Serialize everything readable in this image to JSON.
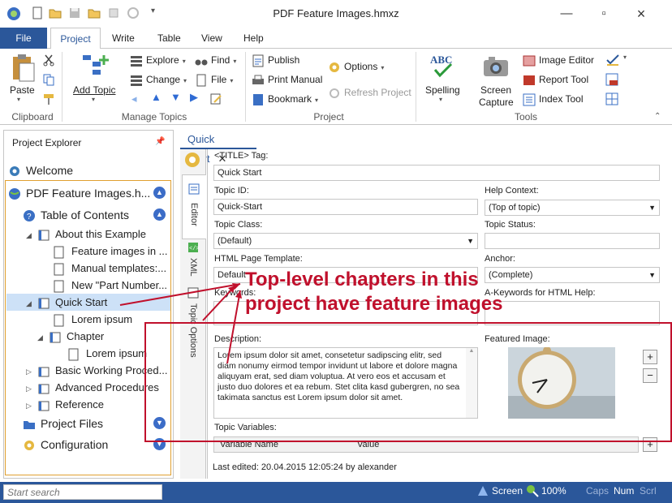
{
  "window": {
    "title": "PDF Feature Images.hmxz"
  },
  "ribbon_tabs": [
    "File",
    "Project",
    "Write",
    "Table",
    "View",
    "Help"
  ],
  "ribbon": {
    "clipboard": {
      "paste": "Paste",
      "group": "Clipboard"
    },
    "manage": {
      "add_topic": "Add Topic",
      "explore": "Explore",
      "change": "Change",
      "find": "Find",
      "file": "File",
      "group": "Manage Topics"
    },
    "project": {
      "publish": "Publish",
      "print_manual": "Print Manual",
      "bookmark": "Bookmark",
      "options": "Options",
      "refresh": "Refresh Project",
      "group": "Project"
    },
    "tools": {
      "spelling": "Spelling",
      "screen_capture_1": "Screen",
      "screen_capture_2": "Capture",
      "image_editor": "Image Editor",
      "report_tool": "Report Tool",
      "index_tool": "Index Tool",
      "group": "Tools"
    }
  },
  "explorer": {
    "header": "Project Explorer",
    "items": [
      {
        "label": "Welcome"
      },
      {
        "label": "PDF Feature Images.h..."
      },
      {
        "label": "Table of Contents"
      },
      {
        "label": "About this Example"
      },
      {
        "label": "Feature images in ..."
      },
      {
        "label": "Manual templates:..."
      },
      {
        "label": "New \"Part Number..."
      },
      {
        "label": "Quick Start"
      },
      {
        "label": "Lorem ipsum"
      },
      {
        "label": "Chapter"
      },
      {
        "label": "Lorem ipsum"
      },
      {
        "label": "Basic Working Proced..."
      },
      {
        "label": "Advanced Procedures"
      },
      {
        "label": "Reference"
      },
      {
        "label": "Project Files"
      },
      {
        "label": "Configuration"
      }
    ]
  },
  "editor": {
    "tab": "Quick Start",
    "side_tabs": [
      "Editor",
      "XML",
      "Topic Options"
    ],
    "title_tag_label": "<TITLE> Tag:",
    "title_tag_value": "Quick Start",
    "topic_id_label": "Topic ID:",
    "topic_id_value": "Quick-Start",
    "help_context_label": "Help Context:",
    "help_context_value": "(Top of topic)",
    "topic_class_label": "Topic Class:",
    "topic_class_value": "(Default)",
    "topic_status_label": "Topic Status:",
    "topic_status_value": "",
    "html_template_label": "HTML Page Template:",
    "html_template_value": "Default",
    "anchor_label": "Anchor:",
    "anchor_value": "(Complete)",
    "keywords_label": "Keywords:",
    "a_keywords_label": "A-Keywords for HTML Help:",
    "description_label": "Description:",
    "description_value": "Lorem ipsum dolor sit amet, consetetur sadipscing elitr, sed diam nonumy eirmod tempor invidunt ut labore et dolore magna aliquyam erat, sed diam voluptua. At vero eos et accusam et justo duo dolores et ea rebum. Stet clita kasd gubergren, no sea takimata sanctus est Lorem ipsum dolor sit amet.",
    "featured_image_label": "Featured Image:",
    "topic_variables_label": "Topic Variables:",
    "var_col_name": "Variable Name",
    "var_col_value": "Value",
    "last_edited": "Last edited: 20.04.2015 12:05:24 by alexander"
  },
  "annotation": {
    "line1": "Top-level chapters in this",
    "line2": "project have feature images",
    "color": "#c0102c"
  },
  "statusbar": {
    "search_placeholder": "Start search",
    "screen": "Screen",
    "zoom": "100%",
    "caps": "Caps",
    "num": "Num",
    "scrl": "Scrl"
  }
}
